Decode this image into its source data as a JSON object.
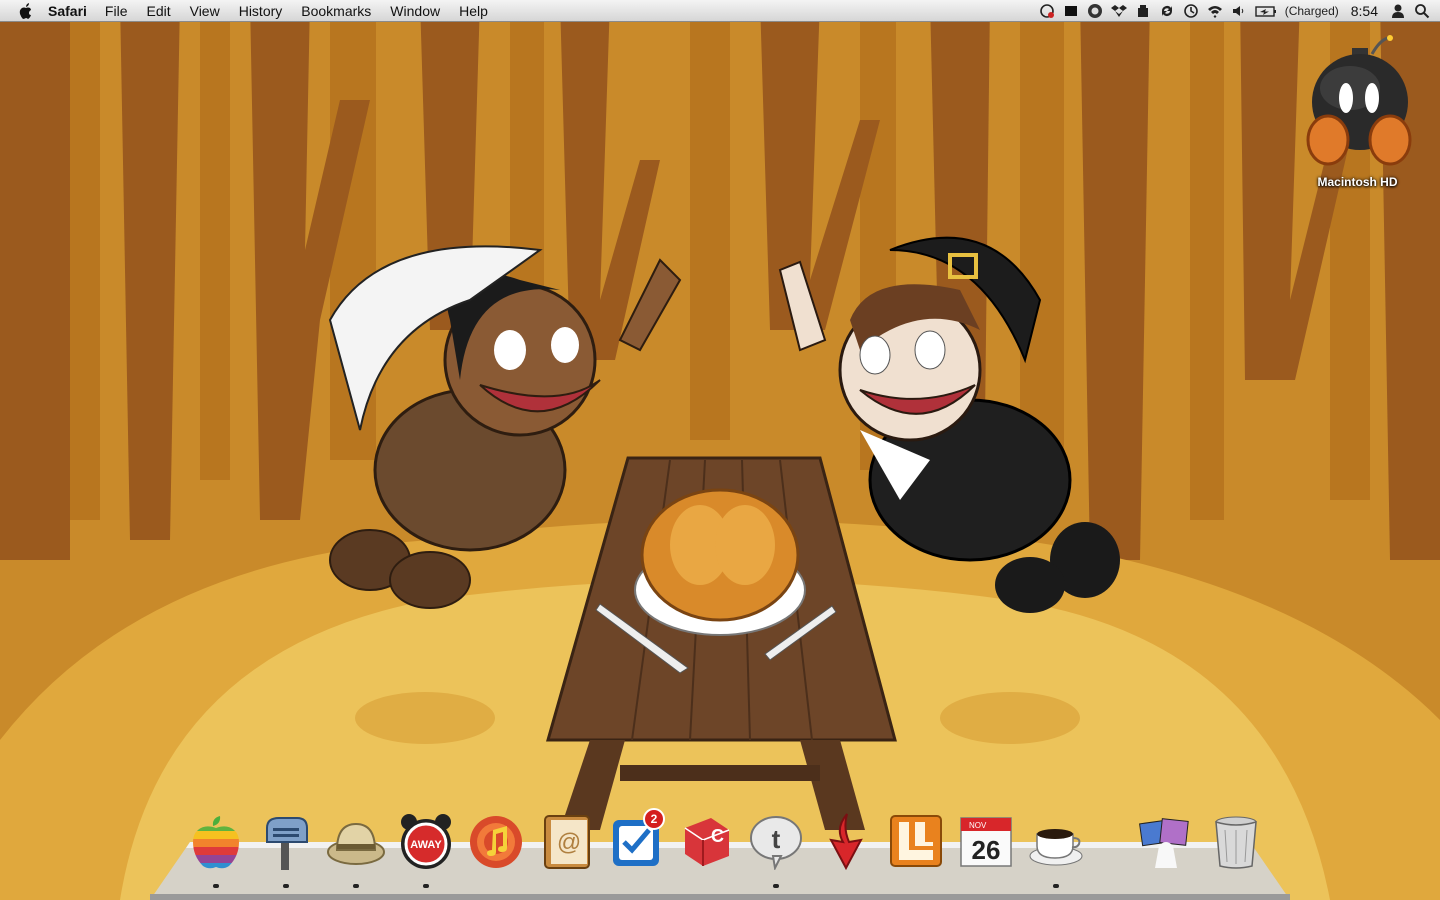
{
  "menubar": {
    "app_name": "Safari",
    "menus": [
      "File",
      "Edit",
      "View",
      "History",
      "Bookmarks",
      "Window",
      "Help"
    ],
    "battery_status": "(Charged)",
    "clock": "8:54",
    "status_icons": [
      "chat-status-icon",
      "black-square-icon",
      "quicksilver-icon",
      "dropbox-icon",
      "box-icon",
      "sync-icon",
      "time-machine-icon",
      "wifi-icon",
      "volume-icon",
      "battery-icon",
      "user-icon",
      "spotlight-icon"
    ]
  },
  "desktop": {
    "icons": [
      {
        "label": "Macintosh HD",
        "icon": "bomb-drive-icon"
      }
    ]
  },
  "dock": {
    "items": [
      {
        "name": "finder-apple",
        "icon": "rainbow-apple-icon",
        "running": true
      },
      {
        "name": "mail",
        "icon": "mailbox-icon",
        "running": true
      },
      {
        "name": "safari-helmet",
        "icon": "pith-helmet-icon",
        "running": true
      },
      {
        "name": "away",
        "icon": "away-alarm-icon",
        "label": "AWAY",
        "running": true
      },
      {
        "name": "itunes",
        "icon": "itunes-icon",
        "running": false
      },
      {
        "name": "address-book",
        "icon": "address-book-icon",
        "running": false
      },
      {
        "name": "things",
        "icon": "checkbox-icon",
        "badge": "2",
        "running": false
      },
      {
        "name": "cut",
        "icon": "red-cube-icon",
        "running": false
      },
      {
        "name": "twitter",
        "icon": "twitter-bubble-icon",
        "running": true
      },
      {
        "name": "downloader",
        "icon": "red-arrow-icon",
        "running": false
      },
      {
        "name": "layout",
        "icon": "orange-layout-icon",
        "running": false
      },
      {
        "name": "ical",
        "icon": "calendar-icon",
        "month": "NOV",
        "day": "26",
        "running": false
      },
      {
        "name": "coffee",
        "icon": "coffee-cup-icon",
        "running": true
      }
    ],
    "right_items": [
      {
        "name": "stacks",
        "icon": "stacks-icon"
      },
      {
        "name": "trash",
        "icon": "trash-icon"
      }
    ]
  },
  "colors": {
    "wallpaper_bg": "#c98a2a",
    "ground": "#e8b84a",
    "trees": "#9b5a1e"
  }
}
